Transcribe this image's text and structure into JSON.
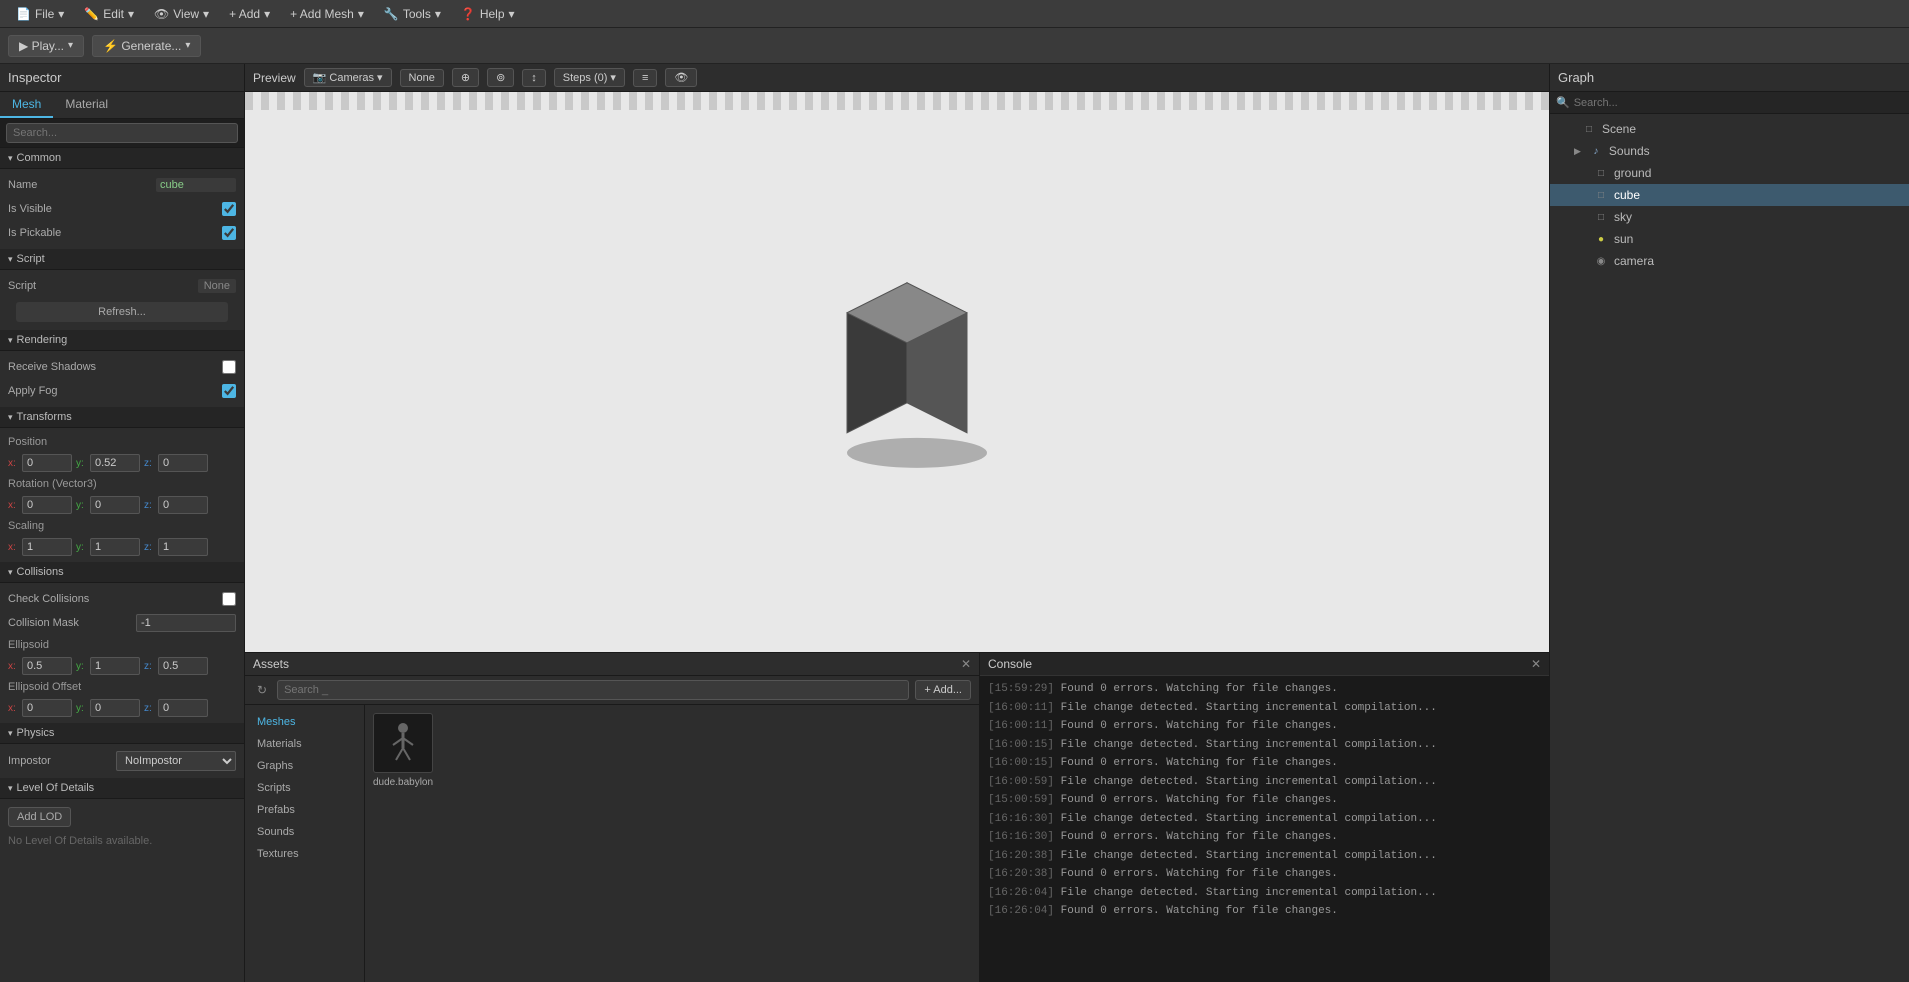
{
  "menuBar": {
    "items": [
      {
        "label": "File",
        "hasArrow": true
      },
      {
        "label": "Edit",
        "hasArrow": true
      },
      {
        "label": "View",
        "hasArrow": true
      },
      {
        "label": "+ Add",
        "hasArrow": true
      },
      {
        "label": "+ Add Mesh",
        "hasArrow": true
      },
      {
        "label": "Tools",
        "hasArrow": true
      },
      {
        "label": "Help",
        "hasArrow": true
      }
    ]
  },
  "toolbar": {
    "play_label": "▶ Play...",
    "generate_label": "⚡ Generate..."
  },
  "inspector": {
    "title": "Inspector",
    "tabs": [
      {
        "label": "Mesh",
        "active": true
      },
      {
        "label": "Material",
        "active": false
      }
    ],
    "searchPlaceholder": "Search...",
    "sections": {
      "common": {
        "label": "Common",
        "name_label": "Name",
        "name_value": "cube",
        "isVisible_label": "Is Visible",
        "isVisible_checked": true,
        "isPickable_label": "Is Pickable",
        "isPickable_checked": true
      },
      "script": {
        "label": "Script",
        "script_label": "Script",
        "script_value": "None",
        "refresh_label": "Refresh..."
      },
      "rendering": {
        "label": "Rendering",
        "receiveShadows_label": "Receive Shadows",
        "receiveShadows_checked": false,
        "applyFog_label": "Apply Fog",
        "applyFog_checked": true
      },
      "transforms": {
        "label": "Transforms",
        "position_label": "Position",
        "position_x": "0",
        "position_y": "0.52",
        "position_z": "0",
        "rotation_label": "Rotation (Vector3)",
        "rotation_x": "0",
        "rotation_y": "0",
        "rotation_z": "0",
        "scaling_label": "Scaling",
        "scaling_x": "1",
        "scaling_y": "1",
        "scaling_z": "1"
      },
      "collisions": {
        "label": "Collisions",
        "checkCollisions_label": "Check Collisions",
        "checkCollisions_checked": false,
        "collisionMask_label": "Collision Mask",
        "collisionMask_value": "-1",
        "ellipsoid_label": "Ellipsoid",
        "ellipsoid_x": "0.5",
        "ellipsoid_y": "1",
        "ellipsoid_z": "0.5",
        "ellipsoidOffset_label": "Ellipsoid Offset",
        "ellipsoidOffset_x": "0",
        "ellipsoidOffset_y": "0",
        "ellipsoidOffset_z": "0"
      },
      "physics": {
        "label": "Physics",
        "impostor_label": "Impostor",
        "impostor_value": "NoImpostor"
      },
      "levelOfDetails": {
        "label": "Level Of Details",
        "addLod_label": "Add LOD",
        "noLod_text": "No Level Of Details available."
      }
    }
  },
  "preview": {
    "title": "Preview",
    "cameras_label": "Cameras",
    "none_label": "None",
    "steps_label": "Steps (0)"
  },
  "assets": {
    "title": "Assets",
    "searchPlaceholder": "Search _",
    "add_label": "+ Add...",
    "navItems": [
      {
        "label": "Meshes",
        "active": true
      },
      {
        "label": "Materials",
        "active": false
      },
      {
        "label": "Graphs",
        "active": false
      },
      {
        "label": "Scripts",
        "active": false
      },
      {
        "label": "Prefabs",
        "active": false
      },
      {
        "label": "Sounds",
        "active": false
      },
      {
        "label": "Textures",
        "active": false
      }
    ],
    "items": [
      {
        "name": "dude.babylon",
        "hasThumb": true
      }
    ]
  },
  "console": {
    "title": "Console",
    "lines": [
      {
        "time": "[15:59:29]",
        "text": "Found 0 errors. Watching for file changes."
      },
      {
        "time": "[16:00:11]",
        "text": "File change detected. Starting incremental compilation..."
      },
      {
        "time": "[16:00:11]",
        "text": "Found 0 errors. Watching for file changes."
      },
      {
        "time": "[16:00:15]",
        "text": "File change detected. Starting incremental compilation..."
      },
      {
        "time": "[16:00:15]",
        "text": "Found 0 errors. Watching for file changes."
      },
      {
        "time": "[16:00:59]",
        "text": "File change detected. Starting incremental compilation..."
      },
      {
        "time": "[15:00:59]",
        "text": "Found 0 errors. Watching for file changes."
      },
      {
        "time": "[16:16:30]",
        "text": "File change detected. Starting incremental compilation..."
      },
      {
        "time": "[16:16:30]",
        "text": "Found 0 errors. Watching for file changes."
      },
      {
        "time": "[16:20:38]",
        "text": "File change detected. Starting incremental compilation..."
      },
      {
        "time": "[16:20:38]",
        "text": "Found 0 errors. Watching for file changes."
      },
      {
        "time": "[16:26:04]",
        "text": "File change detected. Starting incremental compilation..."
      },
      {
        "time": "[16:26:04]",
        "text": "Found 0 errors. Watching for file changes."
      }
    ]
  },
  "graph": {
    "title": "Graph",
    "searchPlaceholder": "Search...",
    "items": [
      {
        "label": "Scene",
        "icon": "🖥",
        "indent": 0,
        "hasArrow": false
      },
      {
        "label": "Sounds",
        "icon": "🔊",
        "indent": 1,
        "hasArrow": true
      },
      {
        "label": "ground",
        "icon": "🖥",
        "indent": 1,
        "hasArrow": false
      },
      {
        "label": "cube",
        "icon": "🖥",
        "indent": 1,
        "hasArrow": false,
        "active": true
      },
      {
        "label": "sky",
        "icon": "🖥",
        "indent": 1,
        "hasArrow": false
      },
      {
        "label": "sun",
        "icon": "💡",
        "indent": 1,
        "hasArrow": false
      },
      {
        "label": "camera",
        "icon": "📷",
        "indent": 1,
        "hasArrow": false
      }
    ]
  }
}
